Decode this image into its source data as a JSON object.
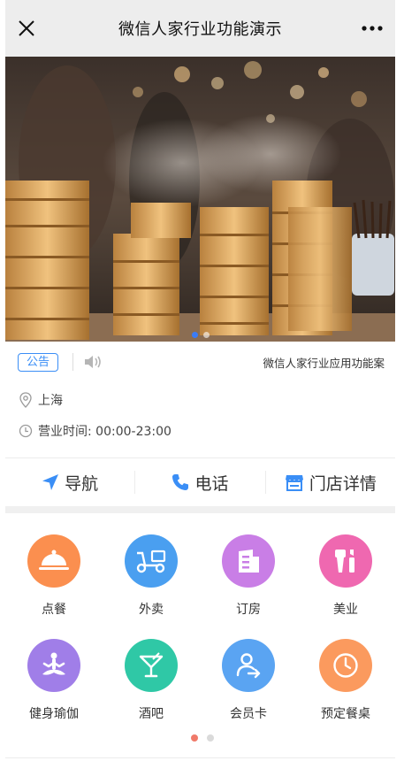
{
  "header": {
    "title": "微信人家行业功能演示",
    "close_icon": "close-icon",
    "more_icon": "more-icon"
  },
  "banner": {
    "dots": 2,
    "active_dot": 1
  },
  "notice": {
    "tag": "公告",
    "text": "微信人家行业应用功能案"
  },
  "info": {
    "address": "上海",
    "hours": "营业时间: 00:00-23:00"
  },
  "actions": [
    {
      "label": "导航",
      "icon": "navigation-icon",
      "color": "#3a8ef6"
    },
    {
      "label": "电话",
      "icon": "phone-icon",
      "color": "#3a8ef6"
    },
    {
      "label": "门店详情",
      "icon": "store-icon",
      "color": "#3a8ef6"
    }
  ],
  "grid": [
    {
      "label": "点餐",
      "icon": "dining-cloche-icon",
      "color": "#fb8f4f"
    },
    {
      "label": "外卖",
      "icon": "scooter-icon",
      "color": "#4a9ff0"
    },
    {
      "label": "订房",
      "icon": "hotel-icon",
      "color": "#c97ee6"
    },
    {
      "label": "美业",
      "icon": "cosmetics-icon",
      "color": "#ef68b0"
    },
    {
      "label": "健身瑜伽",
      "icon": "yoga-icon",
      "color": "#a07ee8"
    },
    {
      "label": "酒吧",
      "icon": "cocktail-icon",
      "color": "#2fc8a6"
    },
    {
      "label": "会员卡",
      "icon": "member-card-icon",
      "color": "#5aa4f2"
    },
    {
      "label": "预定餐桌",
      "icon": "clock-icon",
      "color": "#fb9a5e"
    }
  ],
  "pagination": {
    "pages": 2,
    "active": 0
  }
}
